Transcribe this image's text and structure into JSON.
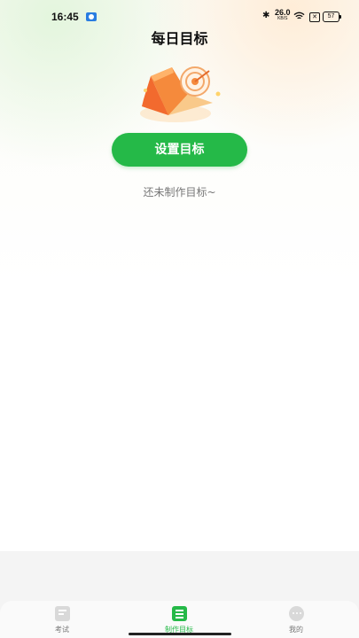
{
  "status_bar": {
    "time": "16:45",
    "network_speed_value": "26.0",
    "network_speed_unit": "KB/S",
    "battery_level": "57",
    "icons": [
      "notification-icon",
      "bluetooth-icon",
      "wifi-icon",
      "sim-x-icon",
      "battery-icon"
    ]
  },
  "header": {
    "title": "每日目标"
  },
  "main": {
    "illustration": "target-book-illustration",
    "cta_label": "设置目标",
    "empty_text": "还未制作目标~"
  },
  "tab_bar": {
    "tabs": [
      {
        "label": "考试",
        "icon": "exam-icon",
        "active": false
      },
      {
        "label": "制作目标",
        "icon": "goal-list-icon",
        "active": true
      },
      {
        "label": "我的",
        "icon": "profile-chat-icon",
        "active": false
      }
    ]
  },
  "colors": {
    "accent_green": "#25b948",
    "inactive_tab": "#777777",
    "header_tint_orange": "#ffecd6",
    "header_tint_green": "#e2f5dc"
  }
}
